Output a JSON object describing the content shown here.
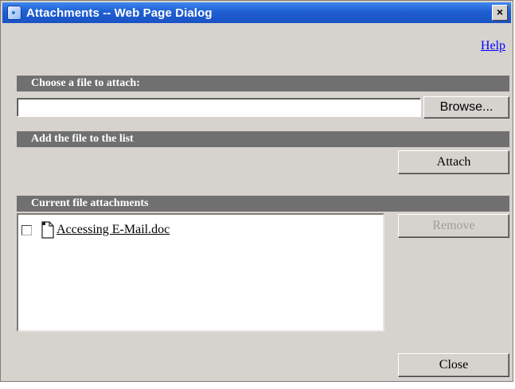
{
  "window": {
    "title": "Attachments -- Web Page Dialog",
    "close_glyph": "×"
  },
  "help": {
    "label": "Help"
  },
  "choose_section": {
    "header": "Choose a file to attach:",
    "file_value": "",
    "browse_label": "Browse..."
  },
  "add_section": {
    "header": "Add the file to the list",
    "attach_label": "Attach"
  },
  "current_section": {
    "header": "Current file attachments",
    "remove_label": "Remove",
    "remove_enabled": false,
    "files": [
      {
        "name": "Accessing E-Mail.doc",
        "checked": false,
        "icon": "document-icon"
      }
    ]
  },
  "footer": {
    "close_label": "Close"
  },
  "colors": {
    "titlebar": "#1f5fd1",
    "dialog_bg": "#d6d3ce",
    "section_bar": "#707070",
    "link": "#0000ff",
    "disabled_text": "#a09d98"
  }
}
